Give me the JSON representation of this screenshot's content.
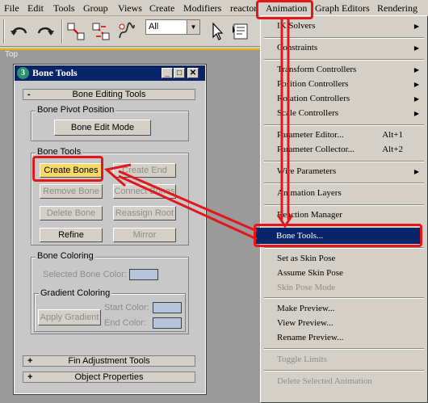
{
  "menubar": {
    "items": [
      "File",
      "Edit",
      "Tools",
      "Group",
      "Views",
      "Create",
      "Modifiers",
      "reactor",
      "Animation",
      "Graph Editors",
      "Rendering"
    ]
  },
  "toolbar": {
    "selection_filter": "All"
  },
  "viewport": {
    "label": "Top"
  },
  "dialog": {
    "title": "Bone Tools",
    "rollouts": {
      "bone_editing": "Bone Editing Tools",
      "fin_adjustment": "Fin Adjustment Tools",
      "object_properties": "Object Properties"
    },
    "bone_pivot_position": {
      "label": "Bone Pivot Position",
      "edit_mode": "Bone Edit Mode"
    },
    "bone_tools": {
      "label": "Bone Tools",
      "create_bones": "Create Bones",
      "create_end": "Create End",
      "remove_bone": "Remove Bone",
      "connect_bones": "Connect Bones",
      "delete_bone": "Delete Bone",
      "reassign_root": "Reassign Root",
      "refine": "Refine",
      "mirror": "Mirror"
    },
    "bone_coloring": {
      "label": "Bone Coloring",
      "selected_color": "Selected Bone Color:",
      "gradient_label": "Gradient Coloring",
      "apply_gradient": "Apply Gradient",
      "start_color": "Start Color:",
      "end_color": "End Color:"
    }
  },
  "animation_menu": {
    "items": [
      {
        "label": "IK Solvers",
        "submenu": true
      },
      {
        "label": "Constraints",
        "submenu": true
      },
      {
        "label": "Transform Controllers",
        "submenu": true
      },
      {
        "label": "Position Controllers",
        "submenu": true
      },
      {
        "label": "Rotation Controllers",
        "submenu": true
      },
      {
        "label": "Scale Controllers",
        "submenu": true
      },
      {
        "label": "Parameter Editor...",
        "shortcut": "Alt+1"
      },
      {
        "label": "Parameter Collector...",
        "shortcut": "Alt+2"
      },
      {
        "label": "Wire Parameters",
        "submenu": true
      },
      {
        "label": "Animation Layers"
      },
      {
        "label": "Reaction Manager"
      },
      {
        "label": "Bone Tools..."
      },
      {
        "label": "Set as Skin Pose"
      },
      {
        "label": "Assume Skin Pose"
      },
      {
        "label": "Skin Pose Mode",
        "disabled": true
      },
      {
        "label": "Make Preview..."
      },
      {
        "label": "View Preview..."
      },
      {
        "label": "Rename Preview..."
      },
      {
        "label": "Toggle Limits",
        "disabled": true
      },
      {
        "label": "Delete Selected Animation",
        "disabled": true
      }
    ]
  },
  "colors": {
    "title_bar": "#0a246a",
    "annotation_red": "#e3161c",
    "viewport_border": "#e5b400"
  }
}
